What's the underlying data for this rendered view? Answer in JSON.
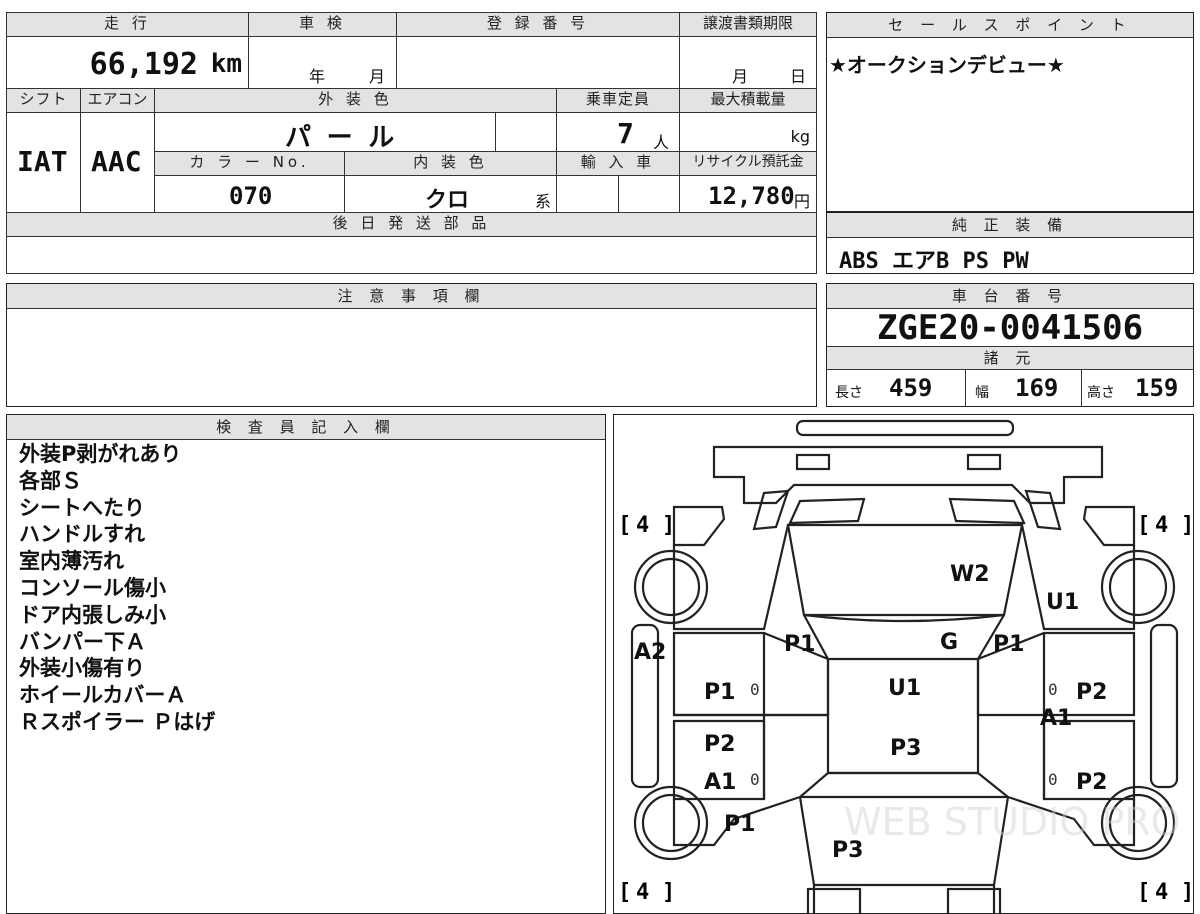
{
  "main_table": {
    "mileage_label": "走 行",
    "mileage_value": "66,192",
    "mileage_unit": "km",
    "shaken_label": "車 検",
    "shaken_year": "年",
    "shaken_month": "月",
    "registration_label": "登 録 番 号",
    "deadline_label": "譲渡書類期限",
    "deadline_month": "月",
    "deadline_day": "日",
    "shift_label": "シフト",
    "shift_value": "IAT",
    "aircon_label": "エアコン",
    "aircon_value": "AAC",
    "exterior_label": "外 装 色",
    "exterior_value": "パ ー ル",
    "capacity_label": "乗車定員",
    "capacity_value": "7",
    "capacity_unit": "人",
    "maxload_label": "最大積載量",
    "maxload_unit": "kg",
    "color_no_label": "カ ラ ー No.",
    "color_no_value": "070",
    "interior_label": "内 装 色",
    "interior_value": "クロ",
    "interior_suffix": "系",
    "import_label": "輸 入 車",
    "recycle_label": "リサイクル預託金",
    "recycle_value": "12,780",
    "recycle_unit": "円",
    "later_parts_label": "後 日 発 送 部 品"
  },
  "sales_point": {
    "label": "セ ー ル ス ポ イ ン ト",
    "text": "★オークションデビュー★"
  },
  "equipment": {
    "label": "純 正 装 備",
    "value": "ABS エアB PS PW"
  },
  "notes": {
    "label": "注 意 事 項 欄"
  },
  "chassis": {
    "label": "車 台 番 号",
    "value": "ZGE20-0041506",
    "spec_label": "諸 元",
    "length_label": "長さ",
    "length_value": "459",
    "width_label": "幅",
    "width_value": "169",
    "height_label": "高さ",
    "height_value": "159"
  },
  "inspector": {
    "label": "検 査 員 記 入 欄",
    "lines": [
      "外装P剥がれあり",
      "各部Ｓ",
      "シートへたり",
      "ハンドルすれ",
      "室内薄汚れ",
      "コンソール傷小",
      "ドア内張しみ小",
      "バンパー下Ａ",
      "外装小傷有り",
      "ホイールカバーＡ",
      "Ｒスポイラー Ｐはげ"
    ]
  },
  "diagram": {
    "tires": [
      "4",
      "4",
      "4",
      "4"
    ],
    "marks": {
      "w2": "W2",
      "u1_top": "U1",
      "p1_left": "P1",
      "g": "G",
      "p1_right": "P1",
      "a2": "A2",
      "p1_door_left": "P1",
      "u1_center": "U1",
      "p2_door_right": "P2",
      "a1_right": "A1",
      "p2_left": "P2",
      "p3_center": "P3",
      "a1_left": "A1",
      "p2_right": "P2",
      "p1_rear_left": "P1",
      "p3_rear": "P3"
    },
    "zeros": [
      "0",
      "0",
      "0",
      "0"
    ],
    "watermark": "WEB STUDIO PRO"
  }
}
